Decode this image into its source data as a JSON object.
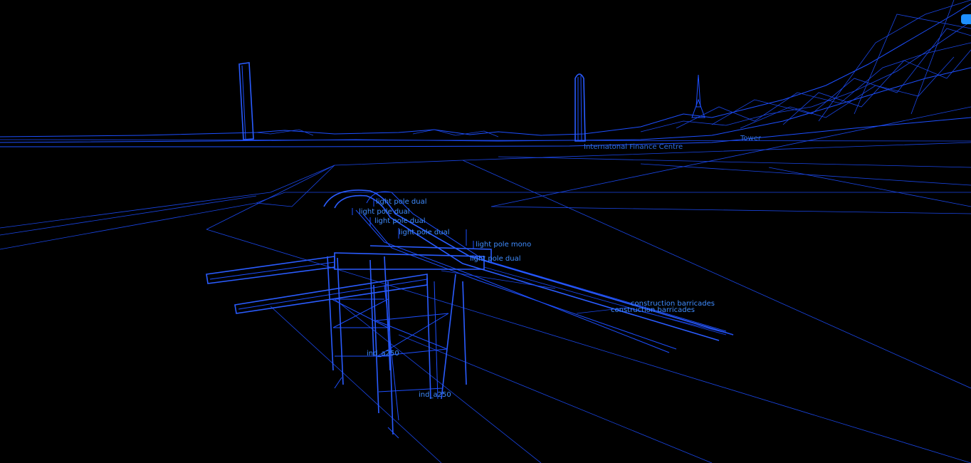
{
  "scene": {
    "render_mode": "wireframe",
    "background": "#000000",
    "wire_color": "#1d4fff",
    "label_color": "#3f8cff"
  },
  "labels": {
    "finance_centre": "Internatonal Finance Centre",
    "tower": "Tower",
    "light_pole_dual_1": "light pole dual",
    "light_pole_dual_2": "light pole dual",
    "light_pole_dual_3": "light pole dual",
    "light_pole_dual_4": "light pole dual",
    "light_pole_mono": "light pole mono",
    "light_pole_dual_5": "light pole dual",
    "barricades_1": "construction barricades",
    "barricades_2": "construction barricades",
    "crane_1": "ind_a250",
    "crane_2": "ind_a250"
  },
  "controls": {
    "corner_button_icon": "panel-toggle-icon"
  }
}
